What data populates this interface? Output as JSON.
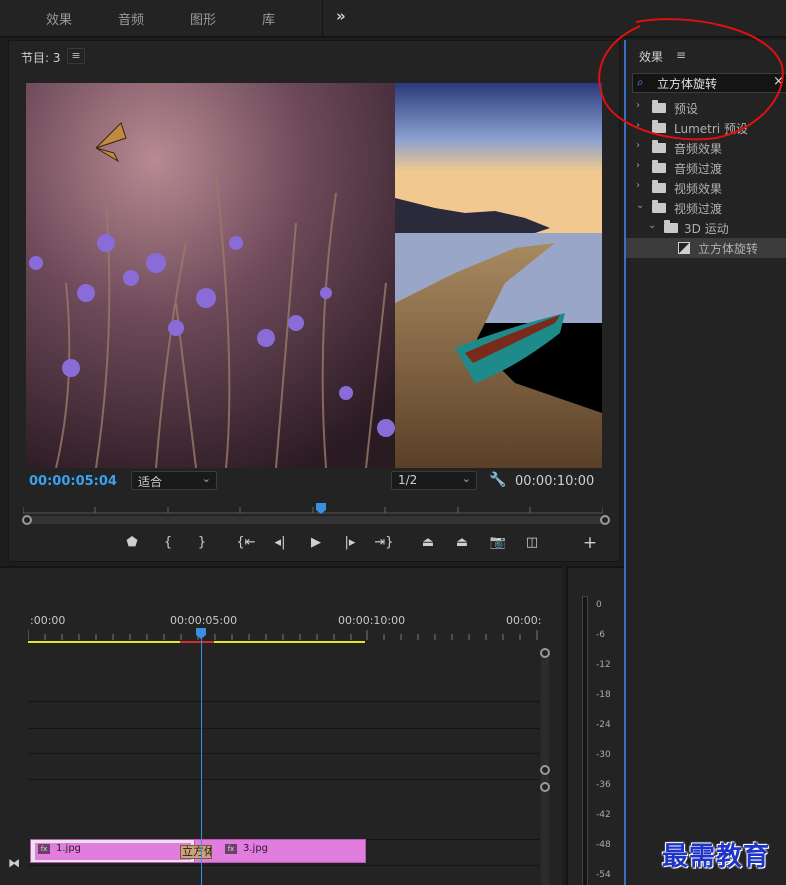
{
  "workspace_tabs": [
    "效果",
    "音频",
    "图形",
    "库"
  ],
  "program_monitor": {
    "title": "节目: 3",
    "menu_icon": "hamburger-icon",
    "current_timecode": "00:00:05:04",
    "fit_option": "适合",
    "resolution": "1/2",
    "duration_timecode": "00:00:10:00"
  },
  "timeline": {
    "ruler_labels": [
      ":00:00",
      "00:00:05:00",
      "00:00:10:00",
      "00:00:"
    ],
    "clips": [
      {
        "name": "1.jpg",
        "badge": "fx"
      },
      {
        "name": "3.jpg",
        "badge": "fx"
      }
    ],
    "transition_label": "立方体"
  },
  "audio_meter": {
    "db_labels": [
      "0",
      "-6",
      "-12",
      "-18",
      "-24",
      "-30",
      "-36",
      "-42",
      "-48",
      "-54"
    ]
  },
  "effects_panel": {
    "title": "效果",
    "menu_icon": "≡",
    "search_value": "立方体旋转",
    "clear_icon": "×",
    "tree": [
      {
        "label": "预设",
        "expanded": false
      },
      {
        "label": "Lumetri 预设",
        "expanded": false
      },
      {
        "label": "音频效果",
        "expanded": false
      },
      {
        "label": "音频过渡",
        "expanded": false
      },
      {
        "label": "视频效果",
        "expanded": false
      },
      {
        "label": "视频过渡",
        "expanded": true
      },
      {
        "label": "3D 运动",
        "expanded": true
      },
      {
        "label": "立方体旋转",
        "selected": true
      }
    ]
  },
  "colors": {
    "accent_blue": "#3aa0f0",
    "clip_pink": "#e27de0",
    "annotation_red": "#e01010",
    "watermark_blue": "#1f34c8"
  },
  "watermark": "最需教育"
}
